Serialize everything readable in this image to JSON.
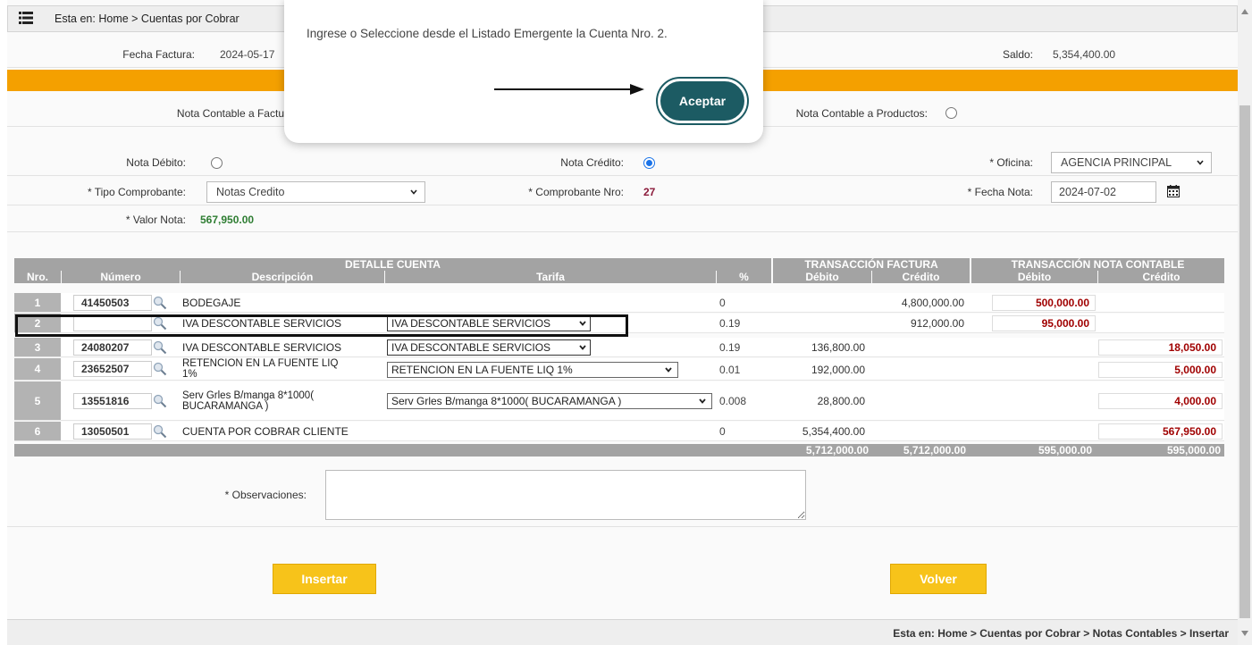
{
  "breadcrumb_top": "Esta en: Home > Cuentas por Cobrar",
  "header": {
    "fecha_factura_label": "Fecha Factura:",
    "fecha_factura_value": "2024-05-17",
    "saldo_label": "Saldo:",
    "saldo_value": "5,354,400.00"
  },
  "nota_tipo": {
    "facturas_label": "Nota Contable a Factu",
    "productos_label": "Nota Contable a Productos:"
  },
  "form": {
    "nota_debito_label": "Nota Débito:",
    "nota_credito_label": "Nota Crédito:",
    "oficina_label": "* Oficina:",
    "oficina_value": "AGENCIA PRINCIPAL",
    "tipo_comprobante_label": "* Tipo Comprobante:",
    "tipo_comprobante_value": "Notas Credito",
    "comprobante_nro_label": "* Comprobante Nro:",
    "comprobante_nro_value": "27",
    "fecha_nota_label": "* Fecha Nota:",
    "fecha_nota_value": "2024-07-02",
    "valor_nota_label": "* Valor Nota:",
    "valor_nota_value": "567,950.00"
  },
  "table": {
    "group_headers": [
      "DETALLE CUENTA",
      "TRANSACCIÓN FACTURA",
      "TRANSACCIÓN NOTA CONTABLE"
    ],
    "columns": [
      "Nro.",
      "Número",
      "Descripción",
      "Tarifa",
      "%",
      "Débito",
      "Crédito",
      "Débito",
      "Crédito"
    ],
    "rows": [
      {
        "nro": "1",
        "numero": "41450503",
        "descripcion": "BODEGAJE",
        "tarifa": "",
        "pct": "0",
        "fact_debito": "",
        "fact_credito": "4,800,000.00",
        "nota_debito": "500,000.00",
        "nota_credito": ""
      },
      {
        "nro": "2",
        "numero": "",
        "descripcion": "IVA DESCONTABLE SERVICIOS",
        "tarifa": "IVA DESCONTABLE SERVICIOS",
        "pct": "0.19",
        "fact_debito": "",
        "fact_credito": "912,000.00",
        "nota_debito": "95,000.00",
        "nota_credito": ""
      },
      {
        "nro": "3",
        "numero": "24080207",
        "descripcion": "IVA DESCONTABLE SERVICIOS",
        "tarifa": "IVA DESCONTABLE SERVICIOS",
        "pct": "0.19",
        "fact_debito": "136,800.00",
        "fact_credito": "",
        "nota_debito": "",
        "nota_credito": "18,050.00"
      },
      {
        "nro": "4",
        "numero": "23652507",
        "descripcion_1": "RETENCION EN LA FUENTE LIQ",
        "descripcion_2": "1%",
        "tarifa": "RETENCION EN LA FUENTE LIQ 1%",
        "pct": "0.01",
        "fact_debito": "192,000.00",
        "fact_credito": "",
        "nota_debito": "",
        "nota_credito": "5,000.00"
      },
      {
        "nro": "5",
        "numero": "13551816",
        "descripcion_1": "Serv Grles B/manga 8*1000(",
        "descripcion_2": "BUCARAMANGA )",
        "tarifa": "Serv Grles B/manga 8*1000( BUCARAMANGA )",
        "pct": "0.008",
        "fact_debito": "28,800.00",
        "fact_credito": "",
        "nota_debito": "",
        "nota_credito": "4,000.00"
      },
      {
        "nro": "6",
        "numero": "13050501",
        "descripcion": "CUENTA POR COBRAR CLIENTE",
        "tarifa": "",
        "pct": "0",
        "fact_debito": "5,354,400.00",
        "fact_credito": "",
        "nota_debito": "",
        "nota_credito": "567,950.00"
      }
    ],
    "totals": {
      "fact_debito": "5,712,000.00",
      "fact_credito": "5,712,000.00",
      "nota_debito": "595,000.00",
      "nota_credito": "595,000.00"
    }
  },
  "observaciones_label": "* Observaciones:",
  "buttons": {
    "insertar": "Insertar",
    "volver": "Volver"
  },
  "breadcrumb_bottom": "Esta en: Home > Cuentas por Cobrar > Notas Contables > Insertar",
  "modal": {
    "message": "Ingrese o Seleccione desde el Listado Emergente la Cuenta Nro. 2.",
    "accept_label": "Aceptar"
  },
  "colors": {
    "accent_orange": "#f4a000",
    "button_yellow": "#f7c31a",
    "modal_button": "#1c5b63",
    "red_value": "#a00000",
    "green_value": "#2e7d32"
  }
}
